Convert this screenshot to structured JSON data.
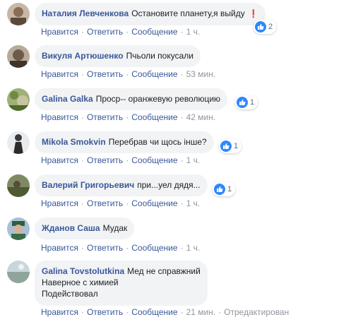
{
  "actions": {
    "like": "Нравится",
    "reply": "Ответить",
    "message": "Сообщение",
    "dot": "·",
    "edited": "Отредактирован"
  },
  "comments": [
    {
      "author": "Наталия Левченкова",
      "text": "Остановите планету,я выйду",
      "emoji": "❗",
      "time": "1 ч.",
      "reactions": "2"
    },
    {
      "author": "Викуля Артюшенко",
      "text": "Пчьоли покусали",
      "time": "53 мин."
    },
    {
      "author": "Galina Galka",
      "text": "Проср-- оранжевую революцию",
      "time": "42 мин.",
      "reactions": "1"
    },
    {
      "author": "Mikola Smokvin",
      "text": "Перебрав чи щось інше?",
      "time": "1 ч.",
      "reactions": "1"
    },
    {
      "author": "Валерий Григорьевич",
      "text": "при...уел дядя...",
      "time": "1 ч.",
      "reactions": "1"
    },
    {
      "author": "Жданов Саша",
      "text": "Мудак",
      "time": "1 ч."
    },
    {
      "author": "Galina Tovstolutkina",
      "lines": [
        "Мед не справжний",
        "Наверное с химией",
        "Подействовал"
      ],
      "time": "21 мин."
    }
  ],
  "colors": {
    "link": "#385898",
    "bubble": "#f2f3f5",
    "meta": "#90949c",
    "like": "#2d88ff"
  },
  "icons": {
    "like": "thumbs-up-icon"
  }
}
